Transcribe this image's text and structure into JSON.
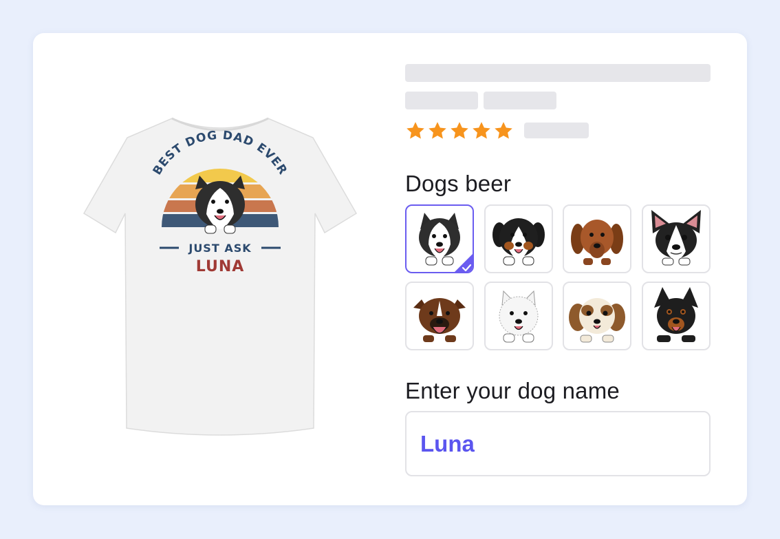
{
  "product": {
    "shirt_text_top": "BEST DOG DAD EVER",
    "shirt_text_mid": "JUST ASK",
    "shirt_text_name": "LUNA",
    "shirt_color": "#f2f2f2",
    "sunset_colors": [
      "#f2c94c",
      "#e7a553",
      "#c9774e",
      "#3e5877"
    ],
    "text_dark": "#2c4a6e",
    "name_color": "#a03a35"
  },
  "rating": {
    "stars": 5,
    "star_color": "#f7941d"
  },
  "breed_section": {
    "label": "Dogs beer",
    "selected_index": 0,
    "accent": "#6a5cf0",
    "options": [
      {
        "breed": "husky",
        "icon": "husky-icon"
      },
      {
        "breed": "bernese",
        "icon": "bernese-icon"
      },
      {
        "breed": "dachshund",
        "icon": "dachshund-icon"
      },
      {
        "breed": "boston-terrier",
        "icon": "boston-terrier-icon"
      },
      {
        "breed": "boxer",
        "icon": "boxer-icon"
      },
      {
        "breed": "westie",
        "icon": "westie-icon"
      },
      {
        "breed": "shih-tzu",
        "icon": "shih-tzu-icon"
      },
      {
        "breed": "rottweiler",
        "icon": "rottweiler-icon"
      }
    ]
  },
  "name_section": {
    "label": "Enter your dog name",
    "value": "Luna"
  }
}
